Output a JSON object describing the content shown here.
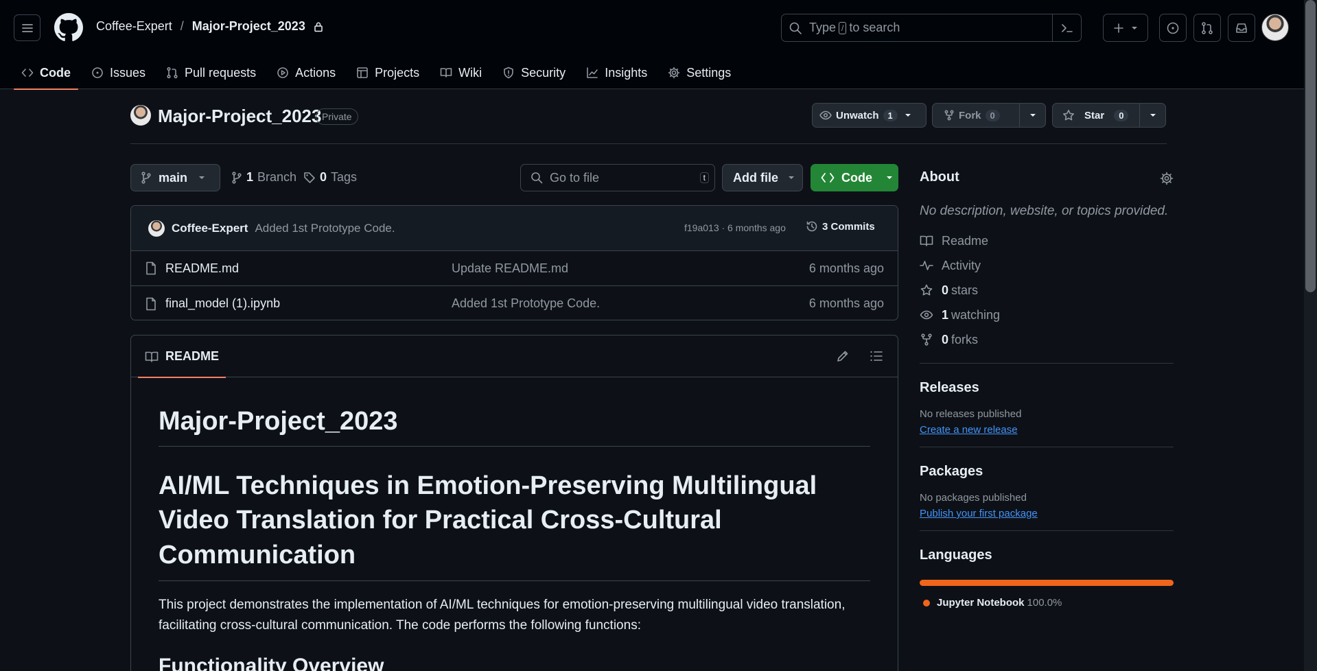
{
  "header": {
    "owner": "Coffee-Expert",
    "separator": "/",
    "repo": "Major-Project_2023",
    "search_prefix": "Type",
    "search_key": "/",
    "search_suffix": "to search"
  },
  "tabs": [
    {
      "label": "Code",
      "icon": "code-icon"
    },
    {
      "label": "Issues",
      "icon": "issue-opened-icon"
    },
    {
      "label": "Pull requests",
      "icon": "git-pull-request-icon"
    },
    {
      "label": "Actions",
      "icon": "play-icon"
    },
    {
      "label": "Projects",
      "icon": "table-icon"
    },
    {
      "label": "Wiki",
      "icon": "book-icon"
    },
    {
      "label": "Security",
      "icon": "shield-icon"
    },
    {
      "label": "Insights",
      "icon": "graph-icon"
    },
    {
      "label": "Settings",
      "icon": "gear-icon"
    }
  ],
  "repo_header": {
    "title": "Major-Project_2023",
    "visibility": "Private",
    "unwatch_label": "Unwatch",
    "unwatch_count": "1",
    "fork_label": "Fork",
    "fork_count": "0",
    "star_label": "Star",
    "star_count": "0"
  },
  "toolbar": {
    "branch": "main",
    "branch_count": "1",
    "branch_label": "Branch",
    "tag_count": "0",
    "tag_label": "Tags",
    "goto_placeholder": "Go to file",
    "goto_key": "t",
    "add_file": "Add file",
    "code": "Code"
  },
  "latest_commit": {
    "author": "Coffee-Expert",
    "message": "Added 1st Prototype Code.",
    "hash_time": "f19a013 · 6 months ago",
    "commits": "3 Commits"
  },
  "files": [
    {
      "name": "README.md",
      "message": "Update README.md",
      "age": "6 months ago"
    },
    {
      "name": "final_model (1).ipynb",
      "message": "Added 1st Prototype Code.",
      "age": "6 months ago"
    }
  ],
  "readme": {
    "tab_label": "README",
    "h1": "Major-Project_2023",
    "h2": "AI/ML Techniques in Emotion-Preserving Multilingual Video Translation for Practical Cross-Cultural Communication",
    "intro": "This project demonstrates the implementation of AI/ML techniques for emotion-preserving multilingual video translation, facilitating cross-cultural communication. The code performs the following functions:",
    "h3": "Functionality Overview"
  },
  "about": {
    "title": "About",
    "description": "No description, website, or topics provided.",
    "readme": "Readme",
    "activity": "Activity",
    "stars_count": "0",
    "stars_label": "stars",
    "watching_count": "1",
    "watching_label": "watching",
    "forks_count": "0",
    "forks_label": "forks"
  },
  "releases": {
    "title": "Releases",
    "empty": "No releases published",
    "link": "Create a new release"
  },
  "packages": {
    "title": "Packages",
    "empty": "No packages published",
    "link": "Publish your first package"
  },
  "languages": {
    "title": "Languages",
    "items": [
      {
        "name": "Jupyter Notebook",
        "percent": "100.0%",
        "color": "#f0651c"
      }
    ]
  },
  "colors": {
    "accent_tab": "#f78166",
    "primary_button": "#238636",
    "link": "#4493f8"
  }
}
